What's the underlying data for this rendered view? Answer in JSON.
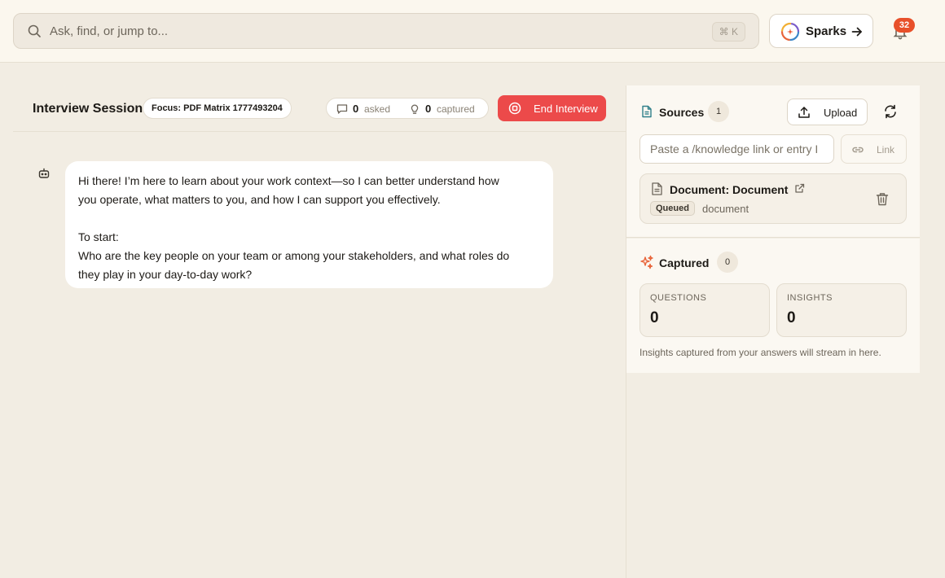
{
  "topbar": {
    "search_placeholder": "Ask, find, or jump to...",
    "shortcut": "⌘ K",
    "sparks_label": "Sparks",
    "notification_count": "32"
  },
  "session": {
    "title": "Interview Session",
    "focus": "Focus: PDF Matrix 1777493204",
    "asked_count": "0",
    "asked_label": "asked",
    "captured_count": "0",
    "captured_label": "captured",
    "end_label": "End Interview"
  },
  "message": {
    "line1": "Hi there! I’m here to learn about your work context—so I can better understand how",
    "line2": "you operate, what matters to you, and how I can support you effectively.",
    "line3": "To start:",
    "line4": "Who are the key people on your team or among your stakeholders, and what roles do",
    "line5": "they play in your day-to-day work?"
  },
  "sources": {
    "title": "Sources",
    "count": "1",
    "upload_label": "Upload",
    "link_placeholder": "Paste a /knowledge link or entry I",
    "link_label": "Link",
    "document": {
      "name": "Document: Document",
      "status": "Queued",
      "type": "document"
    }
  },
  "captured": {
    "title": "Captured",
    "count": "0",
    "questions_label": "QUESTIONS",
    "questions_value": "0",
    "insights_label": "INSIGHTS",
    "insights_value": "0",
    "note": "Insights captured from your answers will stream in here."
  },
  "colors": {
    "accent_red": "#ec4a4a",
    "badge_orange": "#e8502a",
    "sources_teal": "#2f7f8a",
    "captured_orange": "#e8643a"
  }
}
